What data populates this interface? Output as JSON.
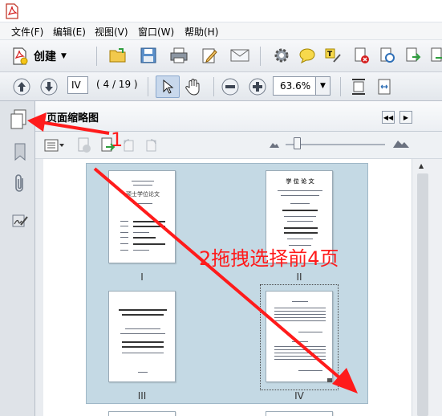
{
  "menu": {
    "items": [
      "文件(F)",
      "编辑(E)",
      "视图(V)",
      "窗口(W)",
      "帮助(H)"
    ]
  },
  "toolbar": {
    "create_label": "创建"
  },
  "navigation": {
    "page_input": "IV",
    "page_count": "( 4 / 19 )",
    "zoom": "63.6%"
  },
  "panel": {
    "title": "页面缩略图"
  },
  "thumbnails": {
    "labels": [
      "I",
      "II",
      "III",
      "IV"
    ],
    "page1_heading": "硕士学位论文",
    "page2_heading": "学 位 论 文"
  },
  "annotations": {
    "step1": "1",
    "step2": "2拖拽选择前4页"
  },
  "colors": {
    "annotation": "#ff1b1b",
    "selection": "#c4d9e4"
  }
}
